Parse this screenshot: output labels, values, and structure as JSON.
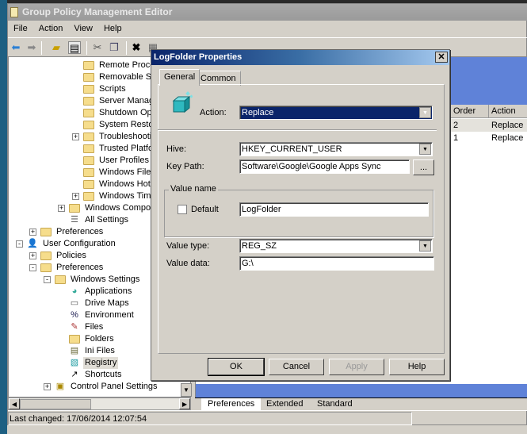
{
  "window": {
    "title": "Group Policy Management Editor"
  },
  "menu": [
    "File",
    "Action",
    "View",
    "Help"
  ],
  "toolbar": {
    "icons": [
      "back-icon",
      "forward-icon",
      "up-folder-icon",
      "show-hide-tree-icon",
      "cut-icon",
      "copy-icon",
      "delete-icon",
      "properties-icon",
      "print-icon",
      "refresh-icon",
      "export-icon",
      "help-icon",
      "console-icon",
      "new-item-icon",
      "stop-icon",
      "plus-icon",
      "up-arrow-icon",
      "order-icon"
    ]
  },
  "tree": [
    {
      "label": "Remote Proced",
      "icon": "folder",
      "level": 5,
      "expander": ""
    },
    {
      "label": "Removable Stor",
      "icon": "folder",
      "level": 5,
      "expander": ""
    },
    {
      "label": "Scripts",
      "icon": "folder",
      "level": 5,
      "expander": ""
    },
    {
      "label": "Server Manage",
      "icon": "folder",
      "level": 5,
      "expander": ""
    },
    {
      "label": "Shutdown Optic",
      "icon": "folder",
      "level": 5,
      "expander": ""
    },
    {
      "label": "System Restore",
      "icon": "folder",
      "level": 5,
      "expander": ""
    },
    {
      "label": "Troubleshooting",
      "icon": "folder",
      "level": 5,
      "expander": "+"
    },
    {
      "label": "Trusted Platforn",
      "icon": "folder",
      "level": 5,
      "expander": ""
    },
    {
      "label": "User Profiles",
      "icon": "folder",
      "level": 5,
      "expander": ""
    },
    {
      "label": "Windows File Pr",
      "icon": "folder",
      "level": 5,
      "expander": ""
    },
    {
      "label": "Windows HotSt",
      "icon": "folder",
      "level": 5,
      "expander": ""
    },
    {
      "label": "Windows Time S",
      "icon": "folder",
      "level": 5,
      "expander": "+"
    },
    {
      "label": "Windows Componer",
      "icon": "folder",
      "level": 4,
      "expander": "+"
    },
    {
      "label": "All Settings",
      "icon": "settings",
      "level": 4,
      "expander": ""
    },
    {
      "label": "Preferences",
      "icon": "folder",
      "level": 2,
      "expander": "+"
    },
    {
      "label": "User Configuration",
      "icon": "user",
      "level": 1,
      "expander": "-"
    },
    {
      "label": "Policies",
      "icon": "folder",
      "level": 2,
      "expander": "+"
    },
    {
      "label": "Preferences",
      "icon": "folder",
      "level": 2,
      "expander": "-"
    },
    {
      "label": "Windows Settings",
      "icon": "folder",
      "level": 3,
      "expander": "-"
    },
    {
      "label": "Applications",
      "icon": "applications",
      "level": 4,
      "expander": ""
    },
    {
      "label": "Drive Maps",
      "icon": "drive",
      "level": 4,
      "expander": ""
    },
    {
      "label": "Environment",
      "icon": "environment",
      "level": 4,
      "expander": ""
    },
    {
      "label": "Files",
      "icon": "files",
      "level": 4,
      "expander": ""
    },
    {
      "label": "Folders",
      "icon": "folder",
      "level": 4,
      "expander": ""
    },
    {
      "label": "Ini Files",
      "icon": "ini",
      "level": 4,
      "expander": ""
    },
    {
      "label": "Registry",
      "icon": "registry",
      "level": 4,
      "expander": "",
      "selected": true
    },
    {
      "label": "Shortcuts",
      "icon": "shortcut",
      "level": 4,
      "expander": ""
    },
    {
      "label": "Control Panel Settings",
      "icon": "control-panel",
      "level": 3,
      "expander": "+"
    }
  ],
  "status": {
    "text": "Last changed: 17/06/2014 12:07:54"
  },
  "list": {
    "columns": [
      "Order",
      "Action"
    ],
    "rows": [
      {
        "order": "2",
        "action": "Replace"
      },
      {
        "order": "1",
        "action": "Replace"
      }
    ]
  },
  "bottom_tabs": [
    "Preferences",
    "Extended",
    "Standard"
  ],
  "dialog": {
    "title": "LogFolder Properties",
    "tabs": [
      "General",
      "Common"
    ],
    "action_label": "Action:",
    "action_value": "Replace",
    "hive_label": "Hive:",
    "hive_value": "HKEY_CURRENT_USER",
    "keypath_label": "Key Path:",
    "keypath_value": "Software\\Google\\Google Apps Sync",
    "browse_label": "...",
    "value_name_group": "Value name",
    "default_label": "Default",
    "default_checked": false,
    "value_name": "LogFolder",
    "value_type_label": "Value type:",
    "value_type": "REG_SZ",
    "value_data_label": "Value data:",
    "value_data": "G:\\",
    "buttons": {
      "ok": "OK",
      "cancel": "Cancel",
      "apply": "Apply",
      "help": "Help"
    }
  },
  "colors": {
    "selection": "#0a246a",
    "pane_blue": "#5f82d8",
    "desktop": "#1d5f82"
  }
}
